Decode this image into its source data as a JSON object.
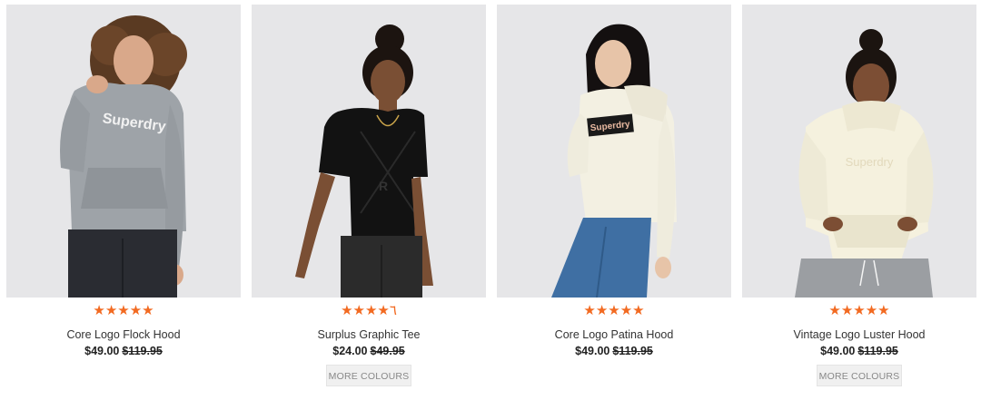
{
  "colors": {
    "star": "#f26a21",
    "image_bg": "#e6e6e8",
    "button_bg": "#f0f0f0"
  },
  "products": [
    {
      "name": "Core Logo Flock Hood",
      "price": "$49.00",
      "was_price": "$119.95",
      "rating": 4.5,
      "stars": "★★★★★",
      "more_colours": "",
      "garment_color": "grey",
      "logo_text": "Superdry"
    },
    {
      "name": "Surplus Graphic Tee",
      "price": "$24.00",
      "was_price": "$49.95",
      "rating": 4,
      "stars": "★★★★٦",
      "more_colours": "MORE COLOURS",
      "garment_color": "black",
      "logo_text": ""
    },
    {
      "name": "Core Logo Patina Hood",
      "price": "$49.00",
      "was_price": "$119.95",
      "rating": 4.5,
      "stars": "★★★★★",
      "more_colours": "",
      "garment_color": "cream",
      "logo_text": "Superdry"
    },
    {
      "name": "Vintage Logo Luster Hood",
      "price": "$49.00",
      "was_price": "$119.95",
      "rating": 5,
      "stars": "★★★★★",
      "more_colours": "MORE COLOURS",
      "garment_color": "cream",
      "logo_text": ""
    }
  ]
}
